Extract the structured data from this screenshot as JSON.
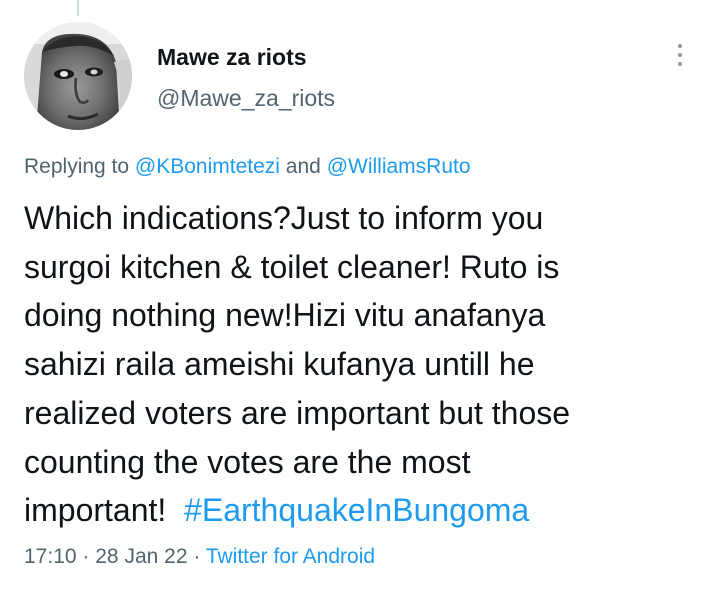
{
  "tweet": {
    "author": {
      "display_name": "Mawe za riots",
      "handle": "@Mawe_za_riots",
      "avatar_icon": "profile-photo"
    },
    "more_icon": "more-vertical-icon",
    "replying_to": {
      "prefix": "Replying to",
      "user1": "@KBonimtetezi",
      "conjunction": "and",
      "user2": "@WilliamsRuto"
    },
    "text": {
      "line1": "Which indications?Just to inform you",
      "line2": "surgoi kitchen & toilet cleaner! Ruto is",
      "line3": "doing nothing new!Hizi vitu anafanya",
      "line4": "sahizi raila ameishi kufanya untill he",
      "line5": "realized voters are important but those",
      "line6": "counting the votes are the most",
      "line7": "important!",
      "hashtag": "#EarthquakeInBungoma"
    },
    "meta": {
      "time": "17:10",
      "separator": "·",
      "date": "28 Jan 22",
      "source": "Twitter for Android"
    },
    "colors": {
      "link": "#1d9bf0",
      "secondary_text": "#536471",
      "primary_text": "#0f1419"
    }
  }
}
